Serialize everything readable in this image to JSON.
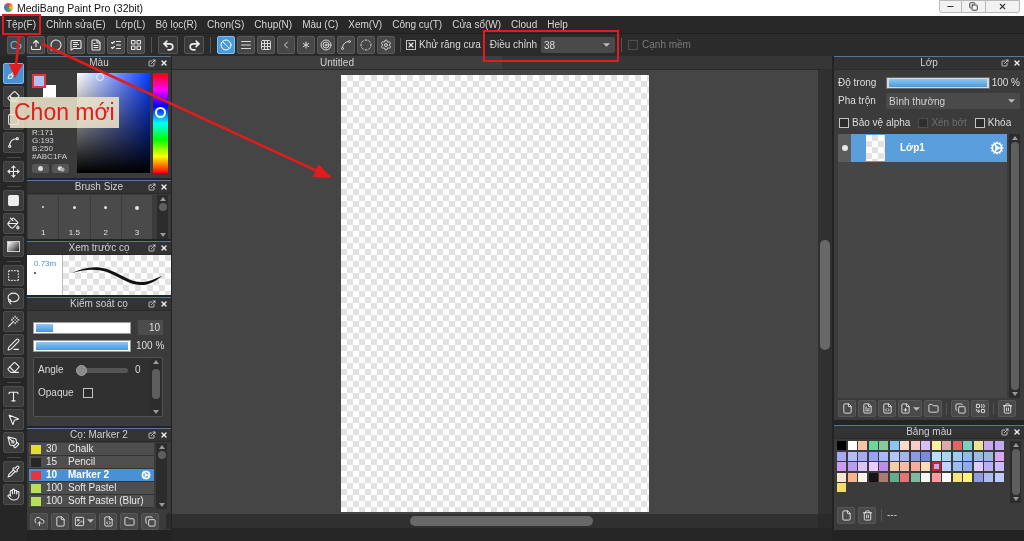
{
  "window": {
    "title": "MediBang Paint Pro (32bit)"
  },
  "menu": [
    {
      "label": "Tệp(F)",
      "highlighted": true
    },
    {
      "label": "Chỉnh sửa(E)",
      "highlighted": false
    },
    {
      "label": "Lớp(L)",
      "highlighted": false
    },
    {
      "label": "Bộ lọc(R)",
      "highlighted": false
    },
    {
      "label": "Chọn(S)",
      "highlighted": false
    },
    {
      "label": "Chụp(N)",
      "highlighted": false
    },
    {
      "label": "Màu (C)",
      "highlighted": false
    },
    {
      "label": "Xem(V)",
      "highlighted": false
    },
    {
      "label": "Công cụ(T)",
      "highlighted": false
    },
    {
      "label": "Cửa sổ(W)",
      "highlighted": false
    },
    {
      "label": "Cloud",
      "highlighted": false
    },
    {
      "label": "Help",
      "highlighted": false
    }
  ],
  "toolbar": {
    "snap_modes": [
      {
        "selected": true
      },
      {
        "selected": false
      },
      {
        "selected": false
      },
      {
        "selected": false
      },
      {
        "selected": false
      },
      {
        "selected": false
      },
      {
        "selected": false
      },
      {
        "selected": false
      }
    ],
    "antialias": {
      "label": "Khử răng cưa",
      "checked": true
    },
    "correction": {
      "label": "Điều chỉnh",
      "value": "38",
      "highlighted": true
    },
    "soft_edge": {
      "label": "Cạnh mềm",
      "checked": false,
      "disabled": true
    }
  },
  "tools": [
    {
      "selected": true
    },
    {
      "selected": false
    },
    {
      "selected": false
    },
    {
      "selected": false
    },
    {
      "selected": false
    },
    {
      "selected": false
    },
    {
      "selected": false
    },
    {
      "selected": false
    },
    {
      "selected": false
    },
    {
      "selected": false
    },
    {
      "selected": false
    },
    {
      "selected": false
    },
    {
      "selected": false
    },
    {
      "selected": false
    },
    {
      "selected": false
    },
    {
      "selected": false
    },
    {
      "selected": false
    },
    {
      "selected": false
    }
  ],
  "color_panel": {
    "title": "Màu",
    "swatches": [
      {
        "kind": "foreground",
        "color": "#abc1fa"
      },
      {
        "kind": "background",
        "color": "#ffffff"
      }
    ],
    "values": [
      "R:171",
      "G:193",
      "B:250",
      "#ABC1FA"
    ]
  },
  "brush_size": {
    "title": "Brush Size",
    "sizes": [
      "1",
      "1.5",
      "2",
      "3"
    ]
  },
  "brush_preview": {
    "title": "Xem trước cọ",
    "size": "0.73m"
  },
  "brush_control": {
    "title": "Kiểm soát cọ",
    "width": {
      "level": 0.19,
      "value": "10"
    },
    "opacity": {
      "level": 1,
      "value": "100 %"
    },
    "angle": {
      "label": "Angle",
      "level": 0,
      "value": "0"
    },
    "opaque": {
      "label": "Opaque",
      "checked": false
    }
  },
  "brushes": {
    "title": "Cọ: Marker 2",
    "items": [
      {
        "size": "30",
        "name": "Chalk",
        "color": "#e6d93a",
        "selected": false
      },
      {
        "size": "15",
        "name": "Pencil",
        "color": "#262626",
        "selected": false
      },
      {
        "size": "10",
        "name": "Marker 2",
        "color": "#e8343a",
        "selected": true
      },
      {
        "size": "100",
        "name": "Soft Pastel",
        "color": "#b4e05a",
        "selected": false
      },
      {
        "size": "100",
        "name": "Soft Pastel (Blur)",
        "color": "#b4e05a",
        "selected": false
      }
    ]
  },
  "document": {
    "tab": "Untitled"
  },
  "layers": {
    "title": "Lớp",
    "opacity": {
      "label": "Độ trong",
      "level": 1,
      "value": "100 %"
    },
    "blend": {
      "label": "Pha trộn",
      "value": "Bình thường"
    },
    "options": [
      {
        "label": "Bảo vệ alpha",
        "checked": false,
        "disabled": false
      },
      {
        "label": "Xén bớt",
        "checked": false,
        "disabled": true
      },
      {
        "label": "Khóa",
        "checked": false,
        "disabled": false
      }
    ],
    "items": [
      {
        "name": "Lớp1",
        "visible": true,
        "selected": true
      }
    ]
  },
  "palette": {
    "title": "Bảng màu",
    "colors": [
      {
        "color": "#000000",
        "selected": false
      },
      {
        "color": "#ffffff",
        "selected": false
      },
      {
        "color": "#f8c4a4",
        "selected": false
      },
      {
        "color": "#6ad89a",
        "selected": false
      },
      {
        "color": "#8cc89c",
        "selected": false
      },
      {
        "color": "#8cc4f4",
        "selected": false
      },
      {
        "color": "#fcdcc8",
        "selected": false
      },
      {
        "color": "#f8ccc8",
        "selected": false
      },
      {
        "color": "#dcbcf8",
        "selected": false
      },
      {
        "color": "#f8f09c",
        "selected": false
      },
      {
        "color": "#dca8a8",
        "selected": false
      },
      {
        "color": "#e46464",
        "selected": false
      },
      {
        "color": "#7cd0c0",
        "selected": false
      },
      {
        "color": "#ece494",
        "selected": false
      },
      {
        "color": "#c8a8ec",
        "selected": false
      },
      {
        "color": "#c4a8f8",
        "selected": false
      },
      {
        "color": "#a8a8f4",
        "selected": false
      },
      {
        "color": "#b4bcf8",
        "selected": false
      },
      {
        "color": "#a4acec",
        "selected": false
      },
      {
        "color": "#98a4f0",
        "selected": false
      },
      {
        "color": "#a8b8f8",
        "selected": false
      },
      {
        "color": "#b4c4fc",
        "selected": false
      },
      {
        "color": "#a4b4ec",
        "selected": false
      },
      {
        "color": "#8c9ce4",
        "selected": false
      },
      {
        "color": "#7c8cdc",
        "selected": false
      },
      {
        "color": "#bcdcfc",
        "selected": false
      },
      {
        "color": "#acd4f4",
        "selected": false
      },
      {
        "color": "#9cccf4",
        "selected": false
      },
      {
        "color": "#8cbcec",
        "selected": false
      },
      {
        "color": "#9cbce4",
        "selected": false
      },
      {
        "color": "#98b8e0",
        "selected": false
      },
      {
        "color": "#dca4f4",
        "selected": false
      },
      {
        "color": "#cc9cf4",
        "selected": false
      },
      {
        "color": "#b89cf4",
        "selected": false
      },
      {
        "color": "#dcc4fc",
        "selected": false
      },
      {
        "color": "#ecccfc",
        "selected": false
      },
      {
        "color": "#bc8cec",
        "selected": false
      },
      {
        "color": "#f8cca4",
        "selected": false
      },
      {
        "color": "#f8bca4",
        "selected": false
      },
      {
        "color": "#f8ac9c",
        "selected": false
      },
      {
        "color": "#f8dcbc",
        "selected": false
      },
      {
        "color": "#a8b8f8",
        "selected": true
      },
      {
        "color": "#bcd4fc",
        "selected": false
      },
      {
        "color": "#9cbcf4",
        "selected": false
      },
      {
        "color": "#8cacec",
        "selected": false
      },
      {
        "color": "#dccdfc",
        "selected": false
      },
      {
        "color": "#bcacf4",
        "selected": false
      },
      {
        "color": "#ccbcfc",
        "selected": false
      },
      {
        "color": "#fce4d4",
        "selected": false
      },
      {
        "color": "#f8b48c",
        "selected": false
      },
      {
        "color": "#fcf4ec",
        "selected": false
      },
      {
        "color": "#141414",
        "selected": false
      },
      {
        "color": "#ac7c74",
        "selected": false
      },
      {
        "color": "#64ac8c",
        "selected": false
      },
      {
        "color": "#e47474",
        "selected": false
      },
      {
        "color": "#7cbc9c",
        "selected": false
      },
      {
        "color": "#fcf4f4",
        "selected": false
      },
      {
        "color": "#fc9c9c",
        "selected": false
      },
      {
        "color": "#fcfcfc",
        "selected": false
      },
      {
        "color": "#f4e474",
        "selected": false
      },
      {
        "color": "#fcf474",
        "selected": false
      },
      {
        "color": "#8c9cdc",
        "selected": false
      },
      {
        "color": "#acbcec",
        "selected": false
      },
      {
        "color": "#bccbfc",
        "selected": false
      },
      {
        "color": "#f4dc6c",
        "selected": false
      }
    ],
    "name": "---"
  },
  "annotations": {
    "callout": "Chon mới"
  }
}
